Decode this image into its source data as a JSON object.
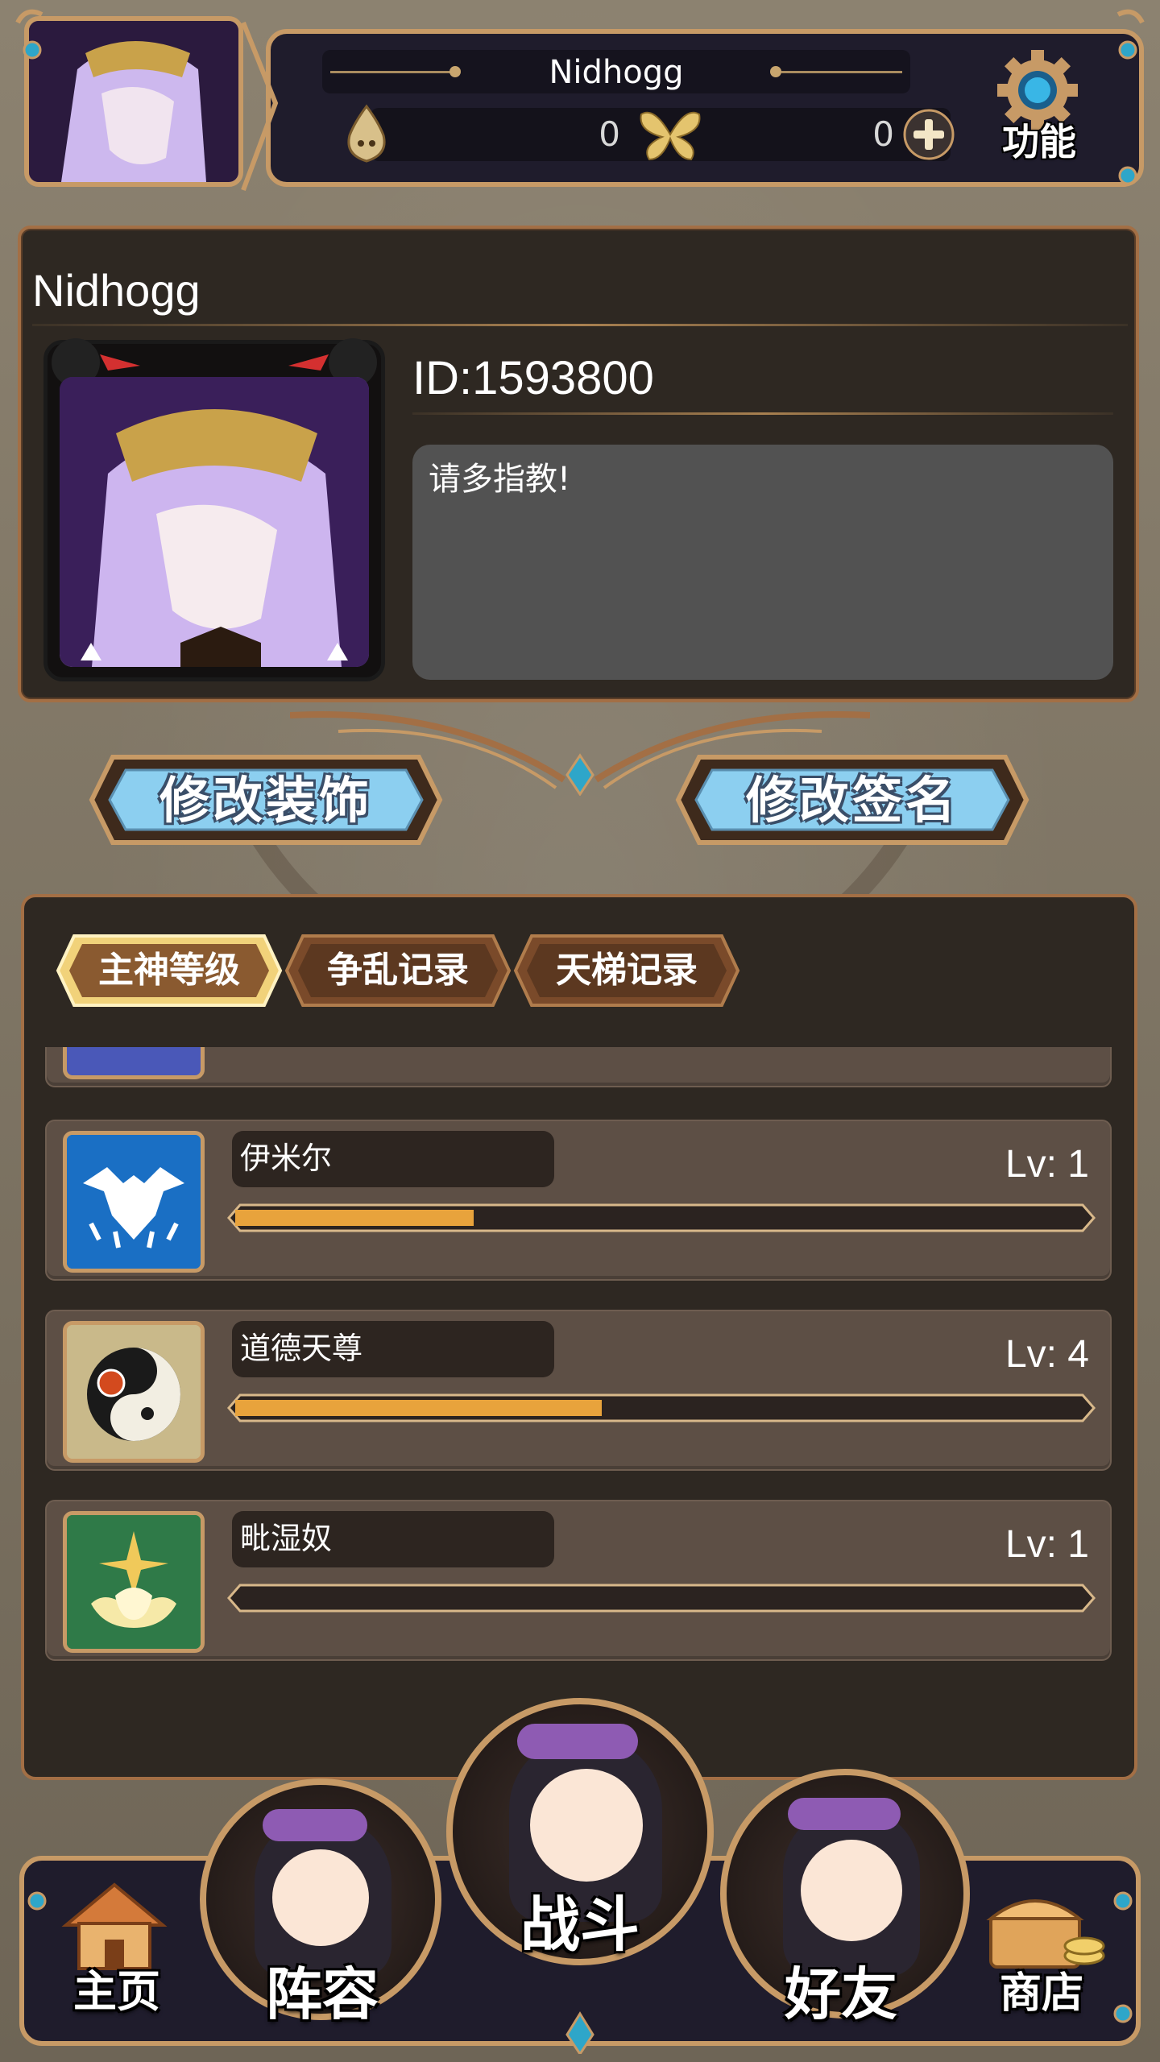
{
  "header": {
    "player_name": "Nidhogg",
    "resource_1": "0",
    "resource_2": "0",
    "function_label": "功能"
  },
  "profile": {
    "name": "Nidhogg",
    "id_text": "ID:1593800",
    "signature": "请多指教!"
  },
  "actions": {
    "edit_decoration": "修改装饰",
    "edit_signature": "修改签名"
  },
  "tabs": [
    {
      "label": "主神等级",
      "active": true
    },
    {
      "label": "争乱记录",
      "active": false
    },
    {
      "label": "天梯记录",
      "active": false
    }
  ],
  "gods": [
    {
      "name": "伊米尔",
      "level": "Lv: 1",
      "progress": 0.28,
      "icon": "frost-antler-icon",
      "icon_bg": "#1a6fc4"
    },
    {
      "name": "道德天尊",
      "level": "Lv: 4",
      "progress": 0.43,
      "icon": "yin-yang-icon",
      "icon_bg": "#c9b98a"
    },
    {
      "name": "毗湿奴",
      "level": "Lv: 1",
      "progress": 0.0,
      "icon": "lotus-icon",
      "icon_bg": "#2f7a48"
    }
  ],
  "nav": {
    "home": "主页",
    "lineup": "阵容",
    "battle": "战斗",
    "friends": "好友",
    "shop": "商店"
  },
  "colors": {
    "frame_gold": "#c79a66",
    "panel_bg": "#2e2822",
    "bar_fill": "#e8a33c",
    "button_blue": "#7fc3e6"
  }
}
